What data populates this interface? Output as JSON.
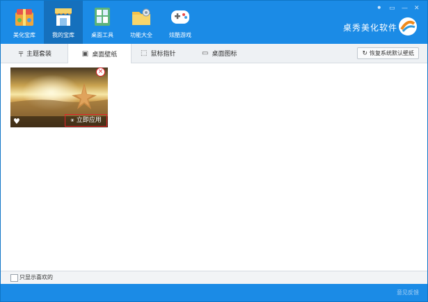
{
  "brand": "桌秀美化软件",
  "window_controls": [
    "⚫",
    "▭",
    "—",
    "✕"
  ],
  "nav": [
    {
      "label": "美化宝库",
      "icon": "gift-box-icon"
    },
    {
      "label": "我的宝库",
      "icon": "storefront-icon"
    },
    {
      "label": "桌面工具",
      "icon": "tools-icon"
    },
    {
      "label": "功能大全",
      "icon": "folder-gear-icon"
    },
    {
      "label": "炫酷游戏",
      "icon": "gamepad-icon"
    }
  ],
  "tabs": [
    {
      "label": "主题套装",
      "icon": "brush-icon"
    },
    {
      "label": "桌面壁纸",
      "icon": "picture-icon"
    },
    {
      "label": "鼠标指针",
      "icon": "cursor-icon"
    },
    {
      "label": "桌面图标",
      "icon": "monitor-icon"
    }
  ],
  "restore_button": "恢复系统默认壁纸",
  "wallpaper_card": {
    "apply_label": "立即应用",
    "heart_icon": "heart-icon",
    "remove_icon": "close-icon"
  },
  "footer": {
    "checkbox_label": "只显示喜欢的",
    "checked": false
  },
  "statusbar": {
    "feedback": "意见反馈"
  },
  "colors": {
    "primary": "#1b8be6",
    "active_nav": "#1570bd",
    "highlight": "#e2232a"
  }
}
